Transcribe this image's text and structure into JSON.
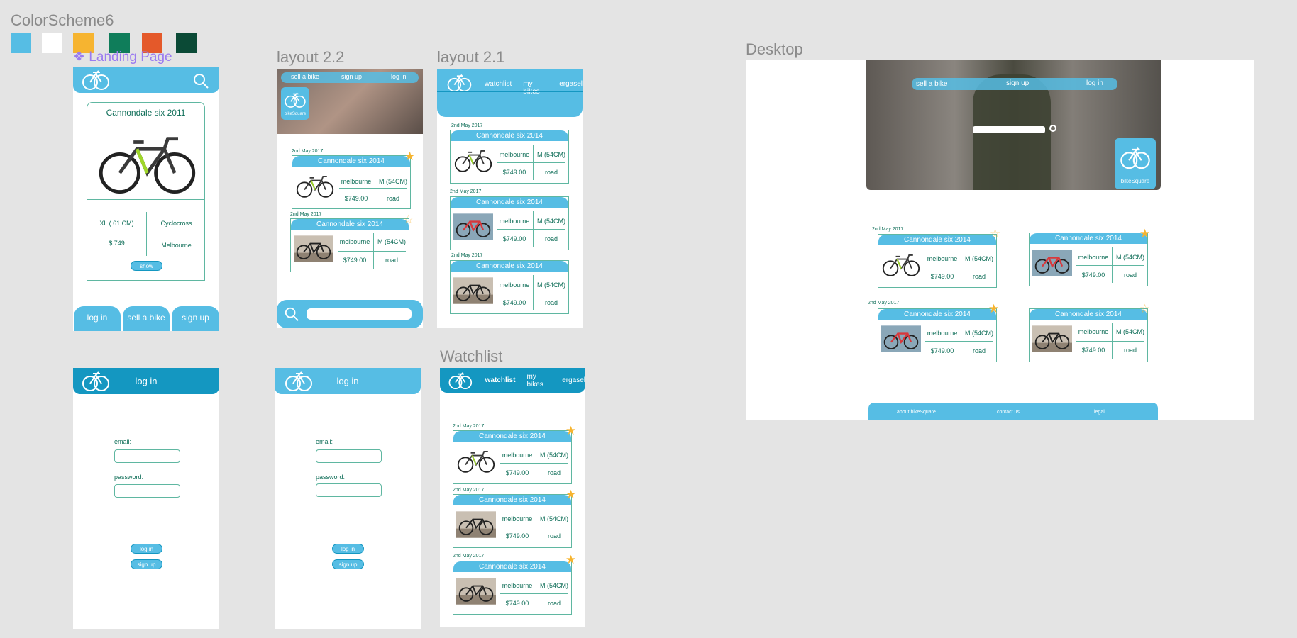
{
  "colorscheme": {
    "title": "ColorScheme6",
    "colors": [
      "#56bde4",
      "#ffffff",
      "#f6b430",
      "#0f7d5a",
      "#e4592a",
      "#0b4a36"
    ]
  },
  "landing": {
    "title": "❖ Landing Page",
    "detail": {
      "name": "Cannondale six 2011",
      "size": "XL ( 61 CM)",
      "type": "Cyclocross",
      "price": "$ 749",
      "city": "Melbourne",
      "show": "show"
    },
    "buttons": {
      "login": "log in",
      "sell": "sell a bike",
      "signup": "sign up"
    }
  },
  "layout22": {
    "title": "layout 2.2",
    "nav": {
      "sell": "sell a bike",
      "signup": "sign up",
      "login": "log in"
    },
    "brand": "bikeSquare"
  },
  "layout21": {
    "title": "layout 2.1",
    "nav": {
      "watchlist": "watchlist",
      "mybikes": "my bikes",
      "ergasel": "ergasel"
    }
  },
  "card": {
    "date": "2nd May 2017",
    "name": "Cannondale six 2014",
    "city": "melbourne",
    "size": "M (54CM)",
    "price": "$749.00",
    "type": "road"
  },
  "login": {
    "title": "log in",
    "email_label": "email:",
    "password_label": "password:",
    "login_button": "log in",
    "signup_button": "sign up"
  },
  "watchlist": {
    "title": "Watchlist",
    "nav": {
      "watchlist": "watchlist",
      "mybikes": "my bikes",
      "ergasel": "ergasel"
    }
  },
  "desktop": {
    "title": "Desktop",
    "nav": {
      "sell": "sell a bike",
      "signup": "sign up",
      "login": "log in"
    },
    "brand": "bikeSquare",
    "footer": {
      "about": "about bikeSquare",
      "contact": "contact us",
      "legal": "legal"
    }
  }
}
